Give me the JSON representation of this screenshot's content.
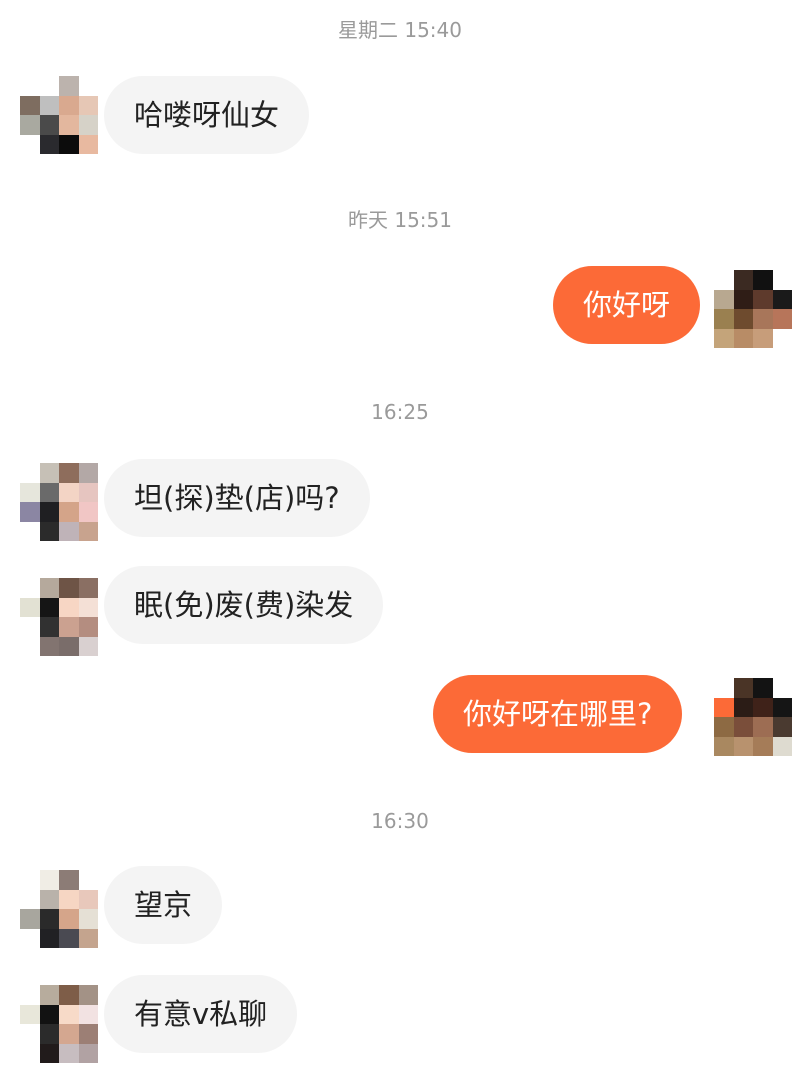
{
  "chat": {
    "timestamps": [
      "星期二 15:40",
      "昨天 15:51",
      "16:25",
      "16:30"
    ],
    "messages": [
      {
        "side": "received",
        "text": "哈喽呀仙女"
      },
      {
        "side": "sent",
        "text": "你好呀"
      },
      {
        "side": "received",
        "text": "坦(探)垫(店)吗?"
      },
      {
        "side": "received",
        "text": "眠(免)废(费)染发"
      },
      {
        "side": "sent",
        "text": "你好呀在哪里?"
      },
      {
        "side": "received",
        "text": "望京"
      },
      {
        "side": "received",
        "text": "有意v私聊"
      }
    ]
  },
  "colors": {
    "sent_bubble": "#fc6a37",
    "received_bubble": "#f4f4f4",
    "timestamp": "#9a9a9a",
    "received_text": "#222222",
    "sent_text": "#ffffff"
  }
}
